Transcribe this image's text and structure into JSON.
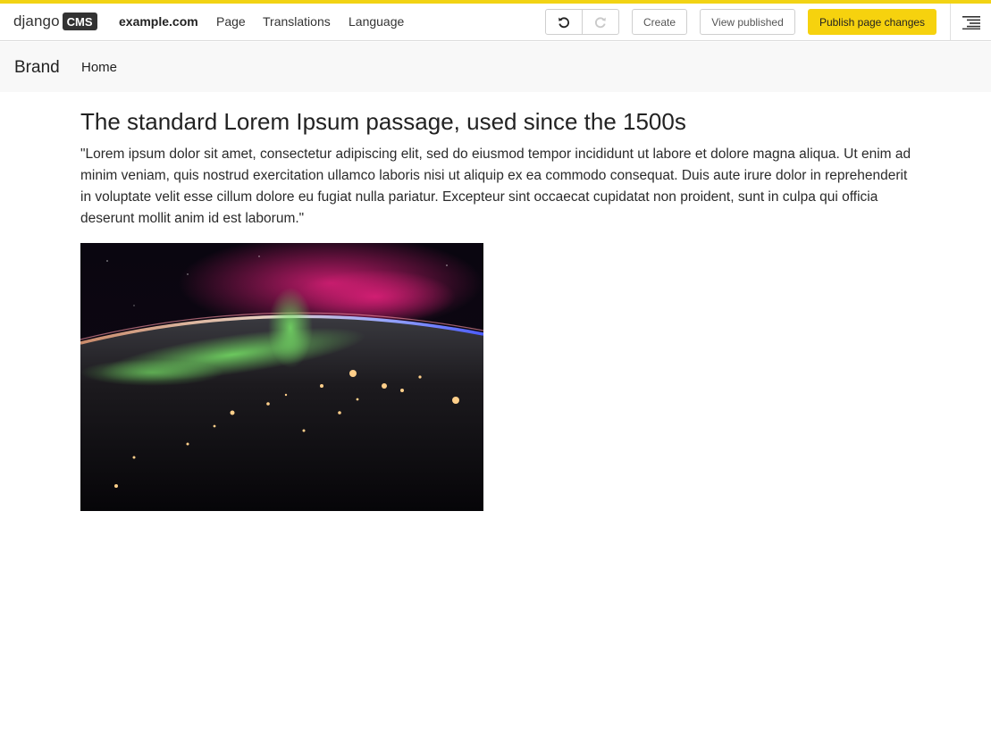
{
  "toolbar": {
    "logo_text": "django",
    "logo_badge": "CMS",
    "site_name": "example.com",
    "menu_items": [
      {
        "label": "Page"
      },
      {
        "label": "Translations"
      },
      {
        "label": "Language"
      }
    ],
    "undo_icon": "undo-icon",
    "redo_icon": "redo-icon",
    "create_label": "Create",
    "view_published_label": "View published",
    "publish_label": "Publish page changes",
    "structure_icon": "structure-mode-icon",
    "accent_color": "#f2d314",
    "publish_color": "#f6d20e"
  },
  "site_nav": {
    "brand": "Brand",
    "items": [
      {
        "label": "Home"
      }
    ]
  },
  "main": {
    "title": "The standard Lorem Ipsum passage, used since the 1500s",
    "body": "\"Lorem ipsum dolor sit amet, consectetur adipiscing elit, sed do eiusmod tempor incididunt ut labore et dolore magna aliqua. Ut enim ad minim veniam, quis nostrud exercitation ullamco laboris nisi ut aliquip ex ea commodo consequat. Duis aute irure dolor in reprehenderit in voluptate velit esse cillum dolore eu fugiat nulla pariatur. Excepteur sint occaecat cupidatat non proident, sunt in culpa qui officia deserunt mollit anim id est laborum.\""
  }
}
